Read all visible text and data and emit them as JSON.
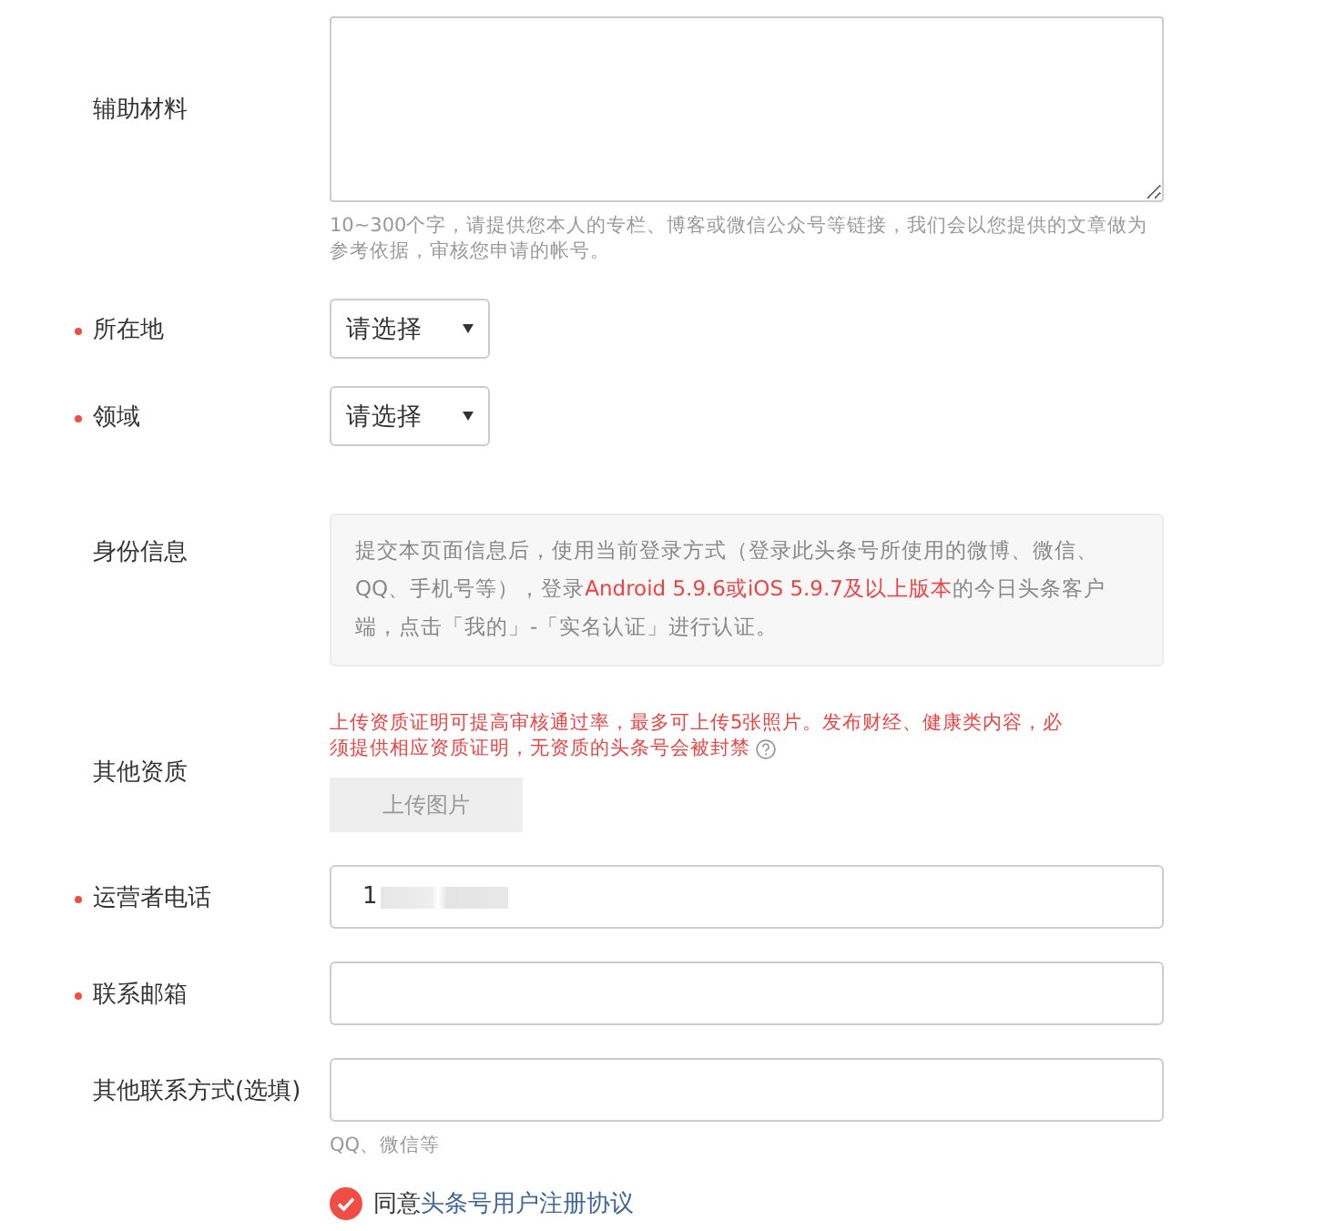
{
  "fields": [
    {
      "kind": "textarea",
      "label": "辅助材料",
      "required": false,
      "hint": "10~300个字，请提供您本人的专栏、博客或微信公众号等链接，我们会以您提供的文章做为参考依据，审核您申请的帐号。"
    },
    {
      "kind": "select",
      "label": "所在地",
      "required": true,
      "value": "请选择"
    },
    {
      "kind": "select",
      "label": "领域",
      "required": true,
      "value": "请选择"
    },
    {
      "kind": "info",
      "label": "身份信息",
      "required": false,
      "segments": [
        {
          "text": "提交本页面信息后，使用当前登录方式（登录此头条号所使用的微博、微信、QQ、手机号等），登录",
          "highlight": false
        },
        {
          "text": "Android 5.9.6或iOS 5.9.7及以上版本",
          "highlight": true
        },
        {
          "text": "的今日头条客户端，点击「我的」-「实名认证」进行认证。",
          "highlight": false
        }
      ]
    },
    {
      "kind": "upload",
      "label": "其他资质",
      "required": false,
      "note_lines": [
        "上传资质证明可提高审核通过率，最多可上传5张照片。发布财经、健康类内容，必",
        "须提供相应资质证明，无资质的头条号会被封禁"
      ],
      "button": "上传图片"
    },
    {
      "kind": "input",
      "label": "运营者电话",
      "required": true,
      "value": "1",
      "blurred": true
    },
    {
      "kind": "input",
      "label": "联系邮箱",
      "required": true,
      "blurred": false
    },
    {
      "kind": "input",
      "label": "其他联系方式(选填)",
      "required": false,
      "blurred": false,
      "hint": "QQ、微信等"
    }
  ],
  "agreement": {
    "checked": true,
    "text": "同意",
    "link": "头条号用户注册协议"
  }
}
